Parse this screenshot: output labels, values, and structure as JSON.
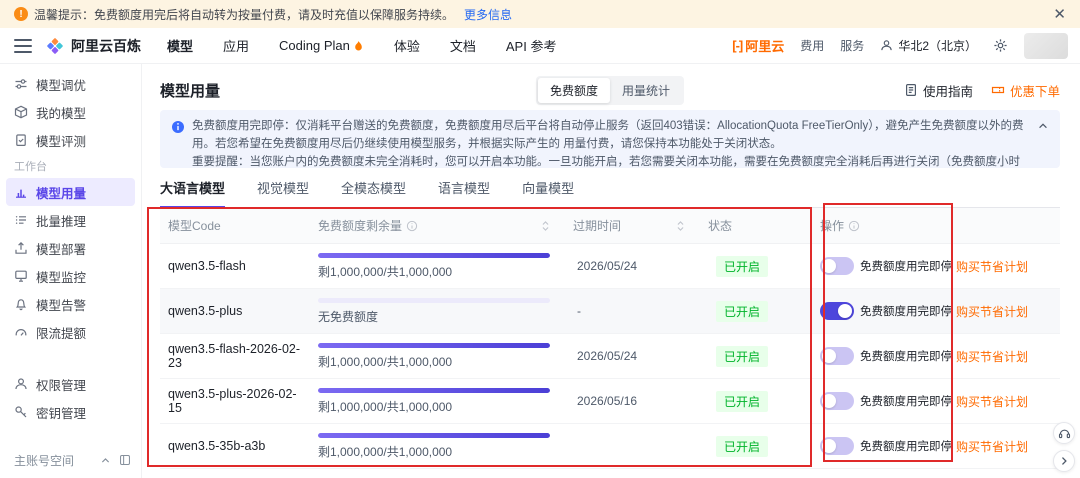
{
  "colors": {
    "accent": "#5a46e8",
    "orange": "#ff6a00",
    "green": "#00b42a",
    "annotation": "#e02a2a",
    "notice_bg": "#f1f4fd",
    "banner_bg": "#fdf4e2"
  },
  "banner": {
    "text": "温馨提示：免费额度用完后将自动转为按量付费，请及时充值以保障服务持续。",
    "link": "更多信息"
  },
  "header": {
    "product": "阿里云百炼",
    "nav": [
      "模型",
      "应用",
      "Coding Plan",
      "体验",
      "文档",
      "API 参考"
    ],
    "brand": "阿里云",
    "billing": "费用",
    "service": "服务",
    "region": "华北2（北京）"
  },
  "sidebar": {
    "items_top": [
      "模型调优",
      "我的模型",
      "模型评测"
    ],
    "section": "工作台",
    "items_work": [
      "模型用量",
      "批量推理",
      "模型部署",
      "模型监控",
      "模型告警",
      "限流提额"
    ],
    "items_admin": [
      "权限管理",
      "密钥管理"
    ],
    "footer": "主账号空间"
  },
  "main": {
    "title": "模型用量",
    "seg": [
      "免费额度",
      "用量统计"
    ],
    "guide": "使用指南",
    "promo": "优惠下单",
    "notice_p1": "免费额度用完即停：仅消耗平台赠送的免费额度，免费额度用尽后平台将自动停止服务（返回403错误：AllocationQuota FreeTierOnly），避免产生免费额度以外的费用。若您希望在免费额度用尽后仍继续使用模型服务，并根据实际产生的 用量付费，请您保持本功能处于关闭状态。",
    "notice_p2": "重要提醒：当您账户内的免费额度未完全消耗时，您可以开启本功能。一旦功能开启，若您需要关闭本功能，需要在免费额度完全消耗后再进行关闭（免费额度小时级出账，数据显示存在延迟，请以控制台显示的免费额度数值为准）。",
    "tabs": [
      "大语言模型",
      "视觉模型",
      "全模态模型",
      "语言模型",
      "向量模型"
    ],
    "table": {
      "col_code": "模型Code",
      "col_quota": "免费额度剩余量",
      "col_expire": "过期时间",
      "col_status": "状态",
      "col_op": "操作",
      "rows": [
        {
          "code": "qwen3.5-flash",
          "quota": "剩1,000,000/共1,000,000",
          "progress": 100,
          "expire": "2026/05/24",
          "status": "已开启",
          "toggle_on": false,
          "toggle_label": "免费额度用完即停",
          "buy": "购买节省计划"
        },
        {
          "code": "qwen3.5-plus",
          "quota": "无免费额度",
          "progress": 0,
          "expire": "-",
          "status": "已开启",
          "toggle_on": true,
          "toggle_label": "免费额度用完即停",
          "buy": "购买节省计划"
        },
        {
          "code": "qwen3.5-flash-2026-02-23",
          "quota": "剩1,000,000/共1,000,000",
          "progress": 100,
          "expire": "2026/05/24",
          "status": "已开启",
          "toggle_on": false,
          "toggle_label": "免费额度用完即停",
          "buy": "购买节省计划"
        },
        {
          "code": "qwen3.5-plus-2026-02-15",
          "quota": "剩1,000,000/共1,000,000",
          "progress": 100,
          "expire": "2026/05/16",
          "status": "已开启",
          "toggle_on": false,
          "toggle_label": "免费额度用完即停",
          "buy": "购买节省计划"
        },
        {
          "code": "qwen3.5-35b-a3b",
          "quota": "剩1,000,000/共1,000,000",
          "progress": 100,
          "expire": "",
          "status": "已开启",
          "toggle_on": false,
          "toggle_label": "免费额度用完即停",
          "buy": "购买节省计划"
        }
      ]
    }
  }
}
